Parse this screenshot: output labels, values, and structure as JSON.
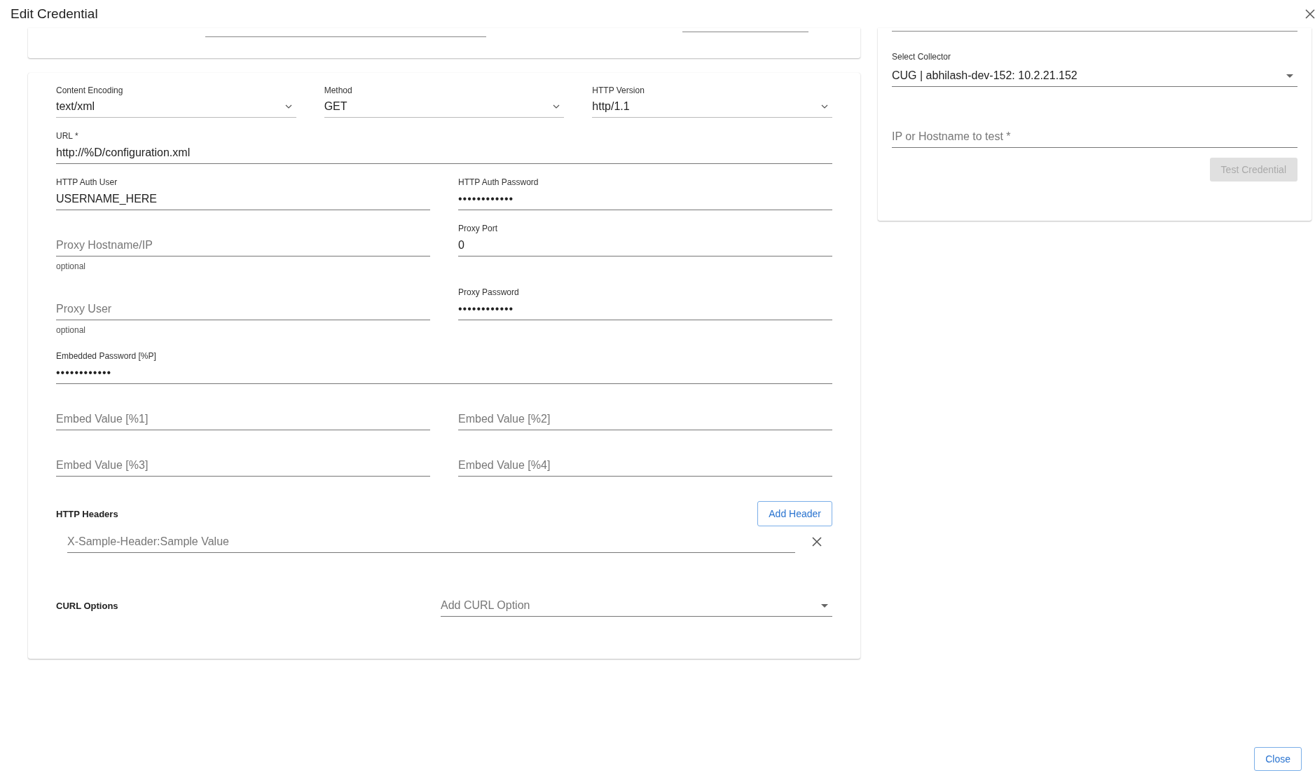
{
  "dialog": {
    "title": "Edit Credential"
  },
  "request_rows": [
    [
      {
        "kind": "select",
        "label": "Content Encoding",
        "value": "text/xml"
      },
      {
        "kind": "select",
        "label": "Method",
        "value": "GET"
      },
      {
        "kind": "select",
        "label": "HTTP Version",
        "value": "http/1.1"
      }
    ],
    [
      {
        "kind": "text",
        "label": "URL *",
        "value": "http://%D/configuration.xml"
      }
    ],
    [
      {
        "kind": "text",
        "label": "HTTP Auth User",
        "value": "USERNAME_HERE"
      },
      {
        "kind": "password",
        "label": "HTTP Auth Password",
        "value": "••••••••••••"
      }
    ],
    [
      {
        "kind": "text",
        "placeholder": "Proxy Hostname/IP",
        "helper": "optional"
      },
      {
        "kind": "text",
        "label": "Proxy Port",
        "value": "0"
      }
    ],
    [
      {
        "kind": "text",
        "placeholder": "Proxy User",
        "helper": "optional"
      },
      {
        "kind": "password",
        "label": "Proxy Password",
        "value": "••••••••••••"
      }
    ],
    [
      {
        "kind": "password",
        "label": "Embedded Password [%P]",
        "value": "••••••••••••"
      }
    ],
    [
      {
        "kind": "text",
        "placeholder": "Embed Value [%1]"
      },
      {
        "kind": "text",
        "placeholder": "Embed Value [%2]"
      }
    ],
    [
      {
        "kind": "text",
        "placeholder": "Embed Value [%3]"
      },
      {
        "kind": "text",
        "placeholder": "Embed Value [%4]"
      }
    ]
  ],
  "http_headers": {
    "title": "HTTP Headers",
    "add_button": "Add Header",
    "headers": [
      {
        "placeholder": "X-Sample-Header:Sample Value"
      }
    ]
  },
  "curl_options": {
    "title": "CURL Options",
    "placeholder": "Add CURL Option"
  },
  "test_panel": {
    "collector": {
      "label": "Select Collector",
      "value": "CUG | abhilash-dev-152: 10.2.21.152"
    },
    "host": {
      "placeholder": "IP or Hostname to test *"
    },
    "test_button": {
      "label": "Test Credential",
      "disabled": true
    }
  },
  "footer": {
    "close_button": "Close"
  }
}
